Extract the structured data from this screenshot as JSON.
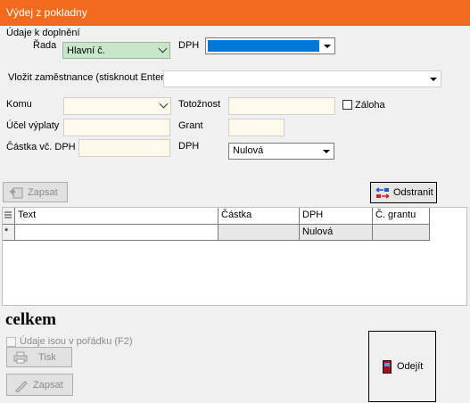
{
  "window": {
    "title": "Výdej z pokladny"
  },
  "form": {
    "section_label": "Údaje k doplnění",
    "rada": {
      "label": "Řada",
      "value": "Hlavní č."
    },
    "dph_top": {
      "label": "DPH",
      "value": ""
    },
    "employee": {
      "label": "Vložit zaměstnance (stisknout Enter)",
      "value": ""
    },
    "komu": {
      "label": "Komu",
      "value": ""
    },
    "totoznost": {
      "label": "Totožnost",
      "value": ""
    },
    "zaloha": {
      "label": "Záloha",
      "checked": false
    },
    "ucel": {
      "label": "Účel výplaty",
      "value": ""
    },
    "grant": {
      "label": "Grant",
      "value": ""
    },
    "castka": {
      "label": "Částka vč. DPH",
      "value": ""
    },
    "dph_bottom": {
      "label": "DPH",
      "value": "Nulová"
    }
  },
  "toolbar": {
    "zapsat_label": "Zapsat",
    "odstranit_label": "Odstranit"
  },
  "grid": {
    "columns": [
      "Text",
      "Částka",
      "DPH",
      "Č. grantu"
    ],
    "new_row_marker": "*",
    "new_row": {
      "text": "",
      "castka": "",
      "dph": "Nulová",
      "grant": ""
    }
  },
  "summary": {
    "celkem_label": "celkem"
  },
  "footer": {
    "confirm_label": "Údaje isou v pořádku (F2)",
    "tisk_label": "Tisk",
    "zapsat_label": "Zapsat",
    "odejit_label": "Odejít"
  },
  "colors": {
    "title_bar": "#f26b1d",
    "field_bg": "#fff9ec",
    "rada_bg": "#c8e6c9",
    "selected": "#0078d7"
  }
}
